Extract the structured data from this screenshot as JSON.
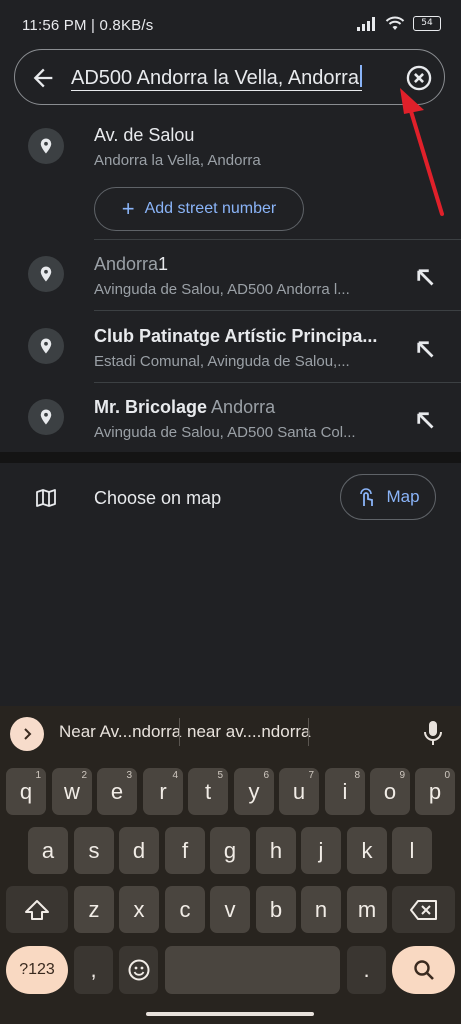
{
  "status_bar": {
    "time_speed": "11:56 PM | 0.8KB/s",
    "battery": "54"
  },
  "search": {
    "query": "AD500 Andorra la Vella, Andorra",
    "back_icon": "arrow-left-icon",
    "clear_icon": "clear-circle-icon"
  },
  "results": [
    {
      "title": "Av. de Salou",
      "title_dim": "",
      "subtitle": "Andorra la Vella, Andorra"
    },
    {
      "title_dim_prefix": "Andorra",
      "title": "1",
      "subtitle": "Avinguda de Salou, AD500 Andorra l..."
    },
    {
      "title": "Club Patinatge Artístic Principa...",
      "subtitle": "Estadi Comunal, Avinguda de Salou,..."
    },
    {
      "title": "Mr. Bricolage",
      "title_dim": " Andorra",
      "subtitle": "Avinguda de Salou, AD500 Santa Col..."
    }
  ],
  "add_street": {
    "label": "Add street number"
  },
  "choose_on_map": {
    "label": "Choose on map",
    "button": "Map"
  },
  "keyboard": {
    "suggestions": [
      "Near Av...ndorra",
      "near av....ndorra"
    ],
    "row1": [
      [
        "q",
        "1"
      ],
      [
        "w",
        "2"
      ],
      [
        "e",
        "3"
      ],
      [
        "r",
        "4"
      ],
      [
        "t",
        "5"
      ],
      [
        "y",
        "6"
      ],
      [
        "u",
        "7"
      ],
      [
        "i",
        "8"
      ],
      [
        "o",
        "9"
      ],
      [
        "p",
        "0"
      ]
    ],
    "row2": [
      "a",
      "s",
      "d",
      "f",
      "g",
      "h",
      "j",
      "k",
      "l"
    ],
    "row3": [
      "z",
      "x",
      "c",
      "v",
      "b",
      "n",
      "m"
    ],
    "symbols": "?123",
    "comma": ",",
    "period": "."
  },
  "colors": {
    "accent": "#8ab4f8",
    "background": "#202124",
    "keyboard": "#28241f",
    "annotation": "#e0202a"
  }
}
